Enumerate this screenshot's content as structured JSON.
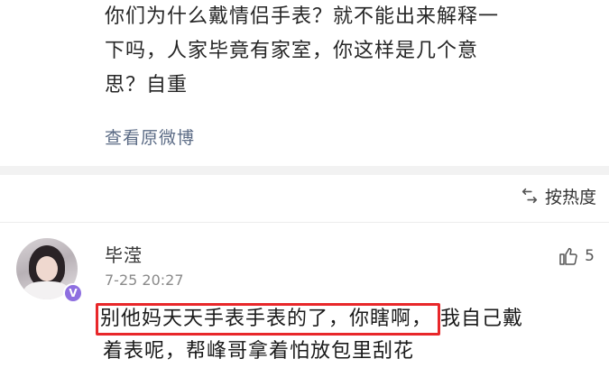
{
  "post": {
    "lines": [
      "你们为什么戴情侣手表？就不能出来解释一",
      "下吗，人家毕竟有家室，你这样是几个意",
      "思？自重"
    ],
    "view_original": "查看原微博"
  },
  "sort": {
    "label": "按热度",
    "icon": "sort-icon"
  },
  "comment": {
    "username": "毕滢",
    "time": "7-25 20:27",
    "verified_badge": "V",
    "like_count": "5",
    "reply_line1_highlight": "别他妈天天手表手表的了，你瞎啊，",
    "reply_line1_rest": "我自己戴",
    "reply_line2": "着表呢，帮峰哥拿着怕放包里刮花"
  },
  "colors": {
    "highlight_border": "#e8272a",
    "link": "#5b6b85",
    "badge": "#8e6fe0"
  }
}
